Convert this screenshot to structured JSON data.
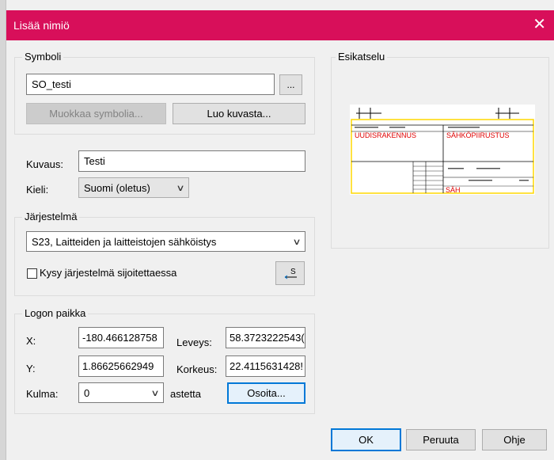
{
  "dialog": {
    "title": "Lisää nimiö",
    "close_icon": "close-icon"
  },
  "symbol_group": {
    "legend": "Symboli",
    "symbol_value": "SO_testi",
    "browse_label": "...",
    "edit_symbol_label": "Muokkaa symbolia...",
    "create_from_picture_label": "Luo kuvasta..."
  },
  "description": {
    "label": "Kuvaus:",
    "value": "Testi"
  },
  "language": {
    "label": "Kieli:",
    "selected": "Suomi (oletus)"
  },
  "system_group": {
    "legend": "Järjestelmä",
    "selected": "S23, Laitteiden ja laitteistojen sähköistys",
    "ask_checkbox_label": "Kysy järjestelmä sijoitettaessa",
    "ask_checked": false,
    "pick_icon": "system-pick-icon"
  },
  "logo_group": {
    "legend": "Logon paikka",
    "x_label": "X:",
    "x_value": "-180.466128758",
    "y_label": "Y:",
    "y_value": "1.86625662949",
    "width_label": "Leveys:",
    "width_value": "58.3723222543(",
    "height_label": "Korkeus:",
    "height_value": "22.4115631428!",
    "angle_label": "Kulma:",
    "angle_value": "0",
    "angle_unit": "astetta",
    "indicate_label": "Osoita..."
  },
  "preview": {
    "legend": "Esikatselu",
    "title_block": {
      "left_heading": "UUDISRAKENNUS",
      "right_heading": "SÄHKÖPIIRUSTUS",
      "bottom_code": "SÄH"
    }
  },
  "footer": {
    "ok_label": "OK",
    "cancel_label": "Peruuta",
    "help_label": "Ohje"
  }
}
